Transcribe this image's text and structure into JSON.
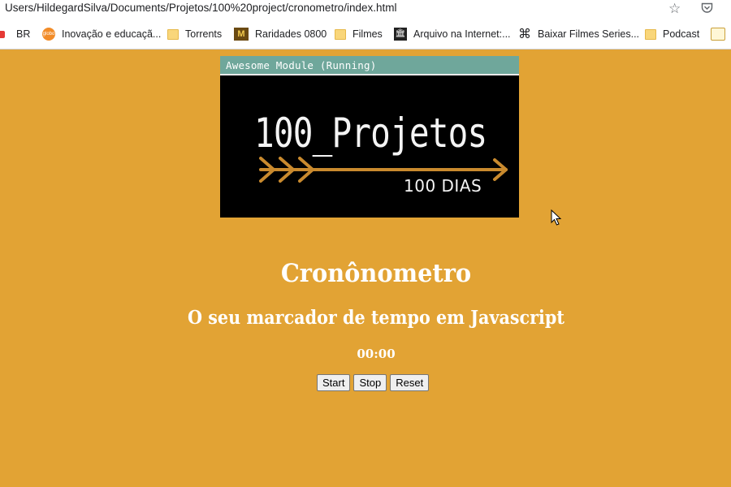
{
  "browser": {
    "url": "Users/HildegardSilva/Documents/Projetos/100%20project/cronometro/index.html",
    "icons": {
      "bookmark_star": "star-icon",
      "pocket": "pocket-icon"
    },
    "bookmarks": [
      {
        "label": "BR",
        "icon": "youtube-icon"
      },
      {
        "label": "Inovação e educaçã...",
        "icon": "globo-icon"
      },
      {
        "label": "Torrents",
        "icon": "folder-icon"
      },
      {
        "label": "Raridades 0800",
        "icon": "raridades-icon"
      },
      {
        "label": "Filmes",
        "icon": "folder-icon"
      },
      {
        "label": "Arquivo na Internet:...",
        "icon": "archive-icon"
      },
      {
        "label": "Baixar Filmes Series...",
        "icon": "command-icon"
      },
      {
        "label": "Podcast",
        "icon": "folder-icon"
      }
    ]
  },
  "banner": {
    "window_title": "Awesome Module (Running)",
    "title": "100_Projetos",
    "subtitle": "100 DIAS",
    "arrow_color": "#c98a2e"
  },
  "page": {
    "title": "Cronônometro",
    "subtitle": "O seu marcador de tempo em Javascript",
    "timer": "00:00",
    "buttons": {
      "start": "Start",
      "stop": "Stop",
      "reset": "Reset"
    },
    "background_color": "#e2a334"
  }
}
